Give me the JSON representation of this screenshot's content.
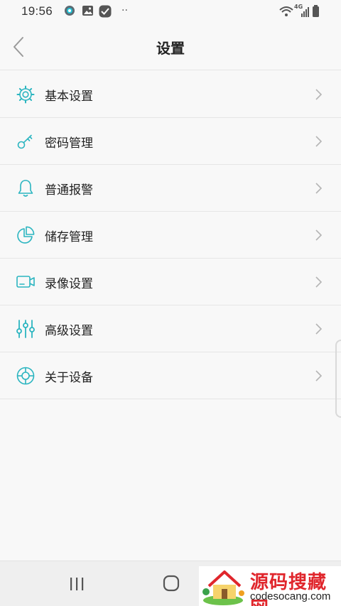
{
  "status_bar": {
    "time": "19:56",
    "network_label": "4G"
  },
  "header": {
    "title": "设置"
  },
  "menu": {
    "items": [
      {
        "label": "基本设置",
        "icon": "gear-icon"
      },
      {
        "label": "密码管理",
        "icon": "key-icon"
      },
      {
        "label": "普通报警",
        "icon": "bell-icon"
      },
      {
        "label": "储存管理",
        "icon": "pie-chart-icon"
      },
      {
        "label": "录像设置",
        "icon": "video-camera-icon"
      },
      {
        "label": "高级设置",
        "icon": "sliders-icon"
      },
      {
        "label": "关于设备",
        "icon": "lifebuoy-icon"
      }
    ]
  },
  "watermark": {
    "title": "源码搜藏网",
    "subtitle": "codesocang.com"
  },
  "colors": {
    "accent": "#2bb5c0",
    "text": "#222222",
    "divider": "#e6e6e6"
  }
}
